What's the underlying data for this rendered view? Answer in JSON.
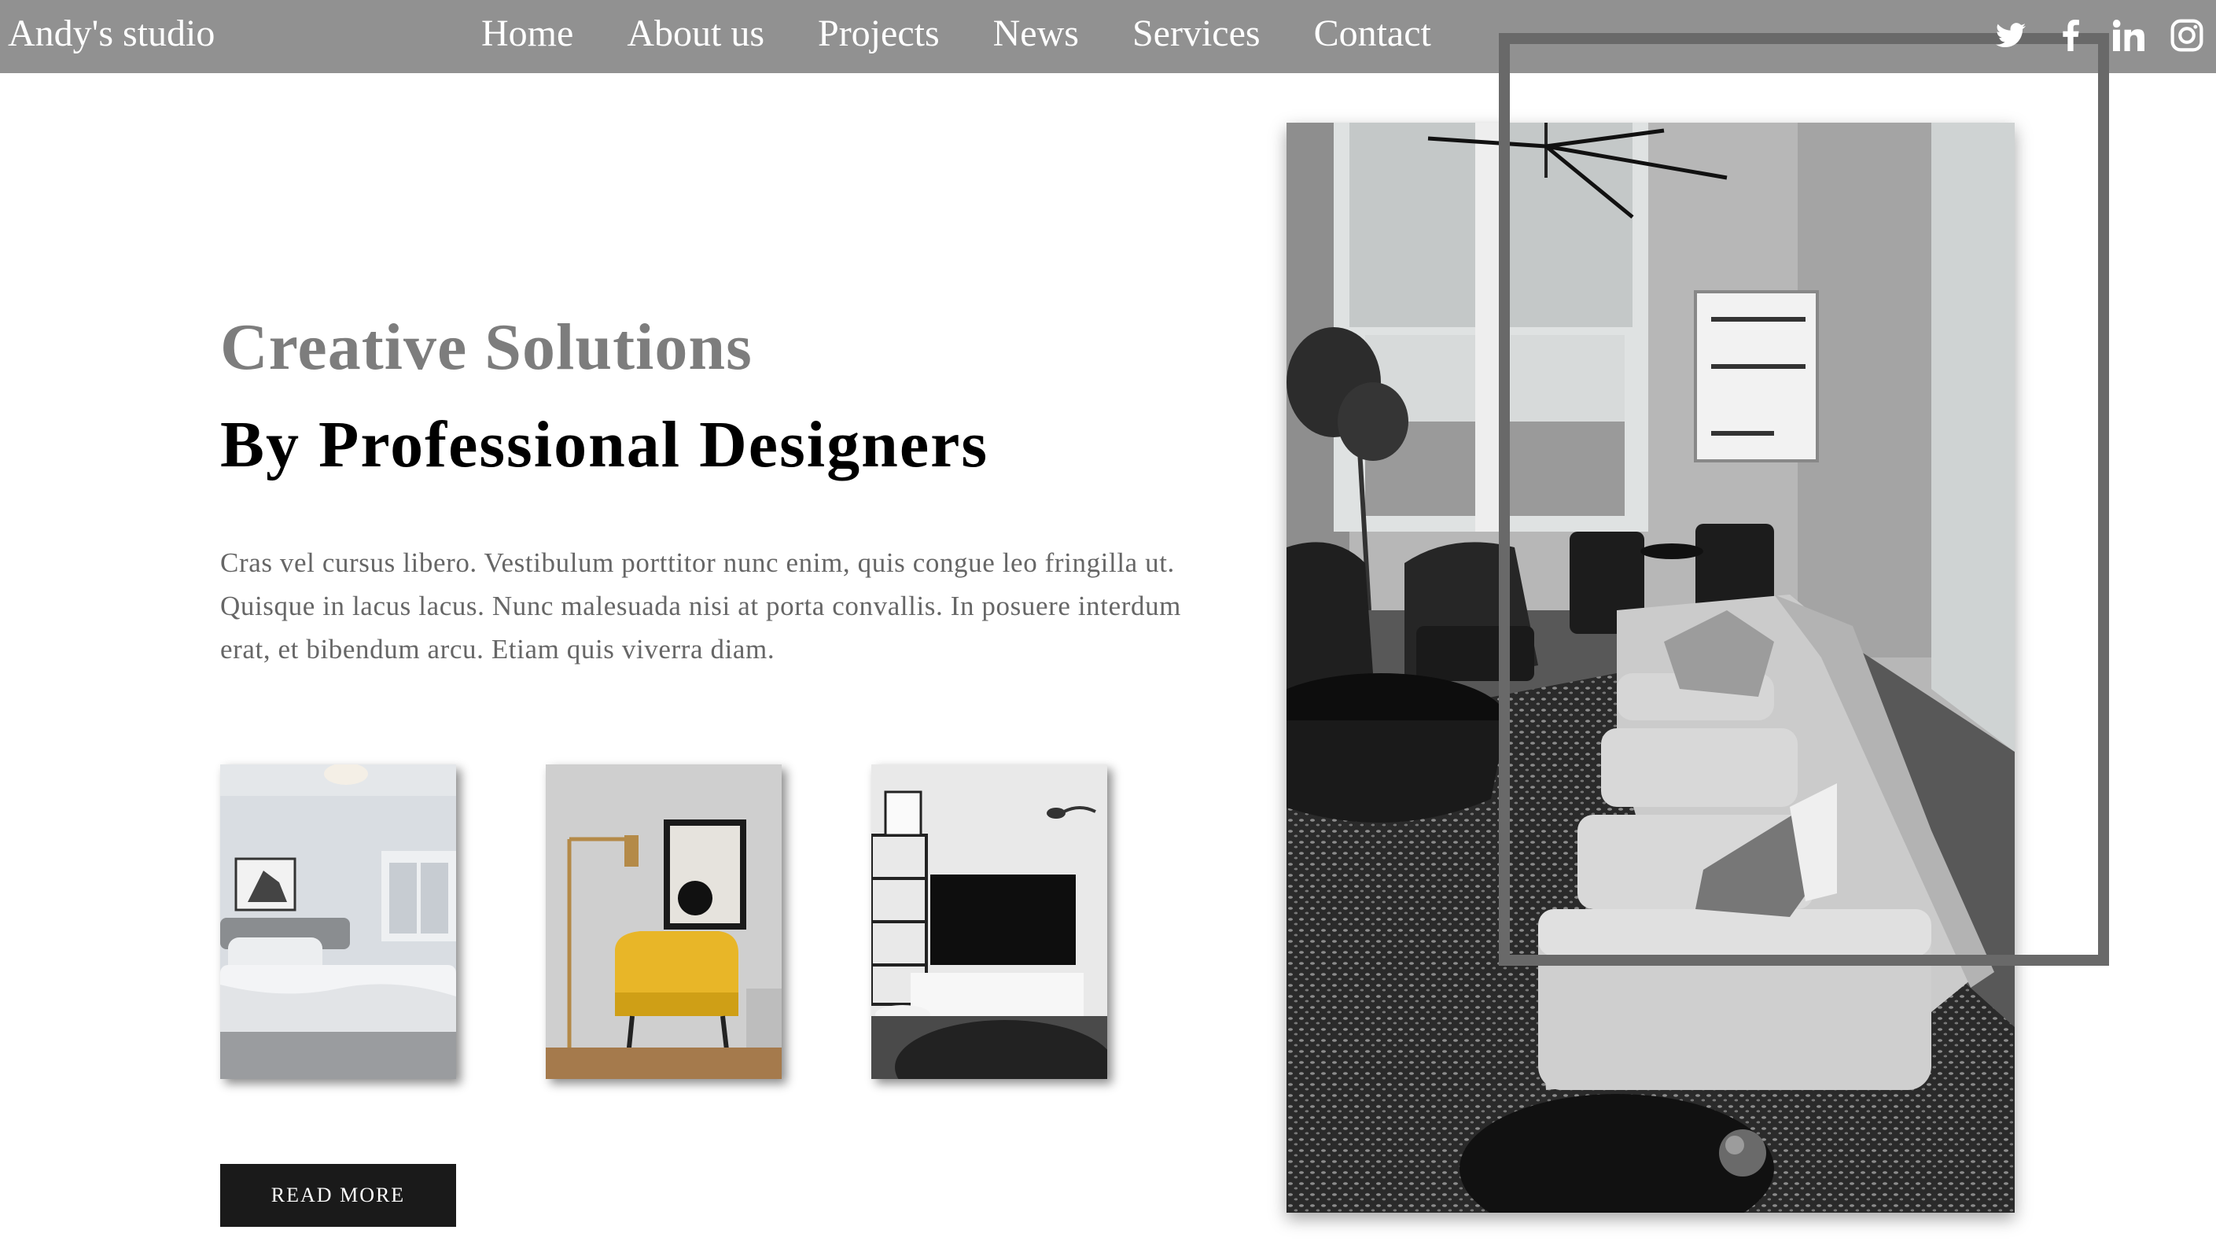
{
  "brand": {
    "name": "Andy's studio"
  },
  "nav": {
    "items": [
      {
        "label": "Home"
      },
      {
        "label": "About us"
      },
      {
        "label": "Projects"
      },
      {
        "label": "News"
      },
      {
        "label": "Services"
      },
      {
        "label": "Contact"
      }
    ]
  },
  "socials": [
    {
      "icon": "twitter-icon"
    },
    {
      "icon": "facebook-icon"
    },
    {
      "icon": "linkedin-icon"
    },
    {
      "icon": "instagram-icon"
    }
  ],
  "hero": {
    "title": "Creative Solutions",
    "subtitle": "By Professional Designers",
    "body": "Cras vel cursus libero. Vestibulum porttitor nunc enim, quis congue leo fringilla ut. Quisque in lacus lacus. Nunc malesuada nisi at porta convallis. In posuere interdum erat, et bibendum arcu. Etiam quis viverra diam."
  },
  "thumbnails": [
    {
      "subject": "bedroom"
    },
    {
      "subject": "yellow armchair with floor lamp"
    },
    {
      "subject": "living room with television"
    }
  ],
  "cta": {
    "label": "READ MORE"
  },
  "main_image": {
    "subject": "living room with grey sectional sofa and tall windows"
  },
  "colors": {
    "nav_bg": "#919191",
    "frame": "#696969",
    "title_grey": "#7d7d7d",
    "button_bg": "#1a1a1a",
    "chair_yellow": "#e8b628"
  }
}
